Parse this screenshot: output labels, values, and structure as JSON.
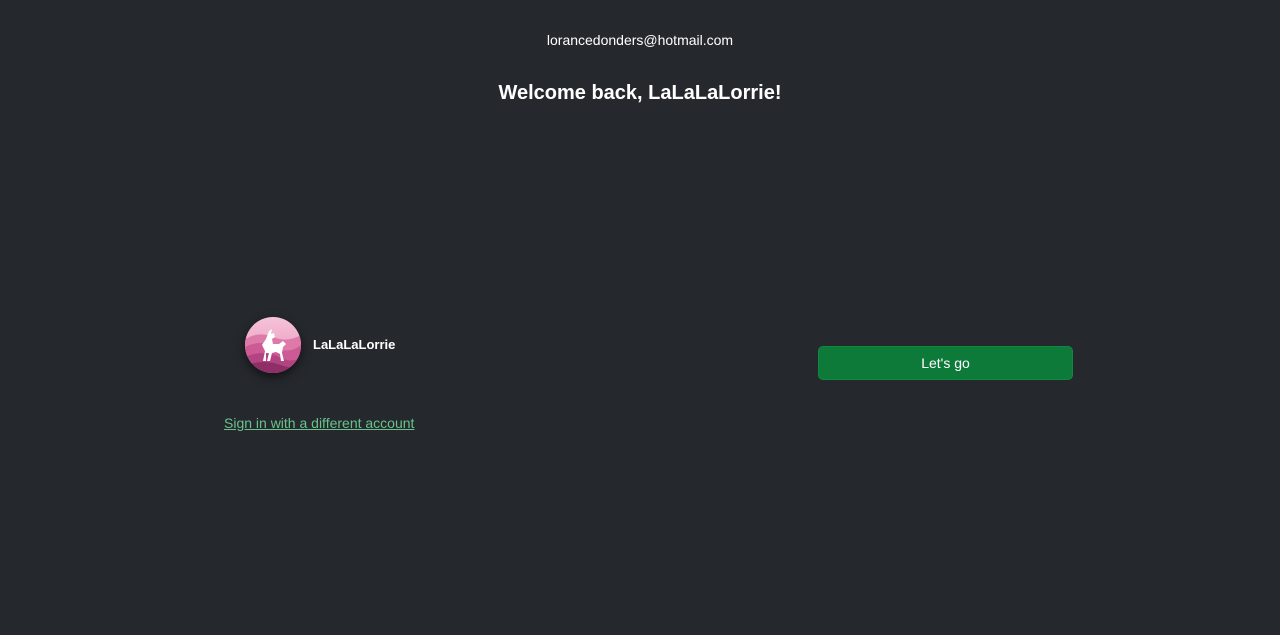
{
  "account": {
    "email": "lorancedonders@hotmail.com",
    "display_name": "LaLaLaLorrie",
    "avatar_icon": "unicorn-mountain-avatar"
  },
  "heading": "Welcome back, LaLaLaLorrie!",
  "actions": {
    "primary_label": "Let's go",
    "switch_account_label": "Sign in with a different account"
  },
  "colors": {
    "background": "#25282d",
    "primary_button": "#0e7a3a",
    "link": "#6ac28b",
    "avatar_pink": "#d45a9a"
  }
}
